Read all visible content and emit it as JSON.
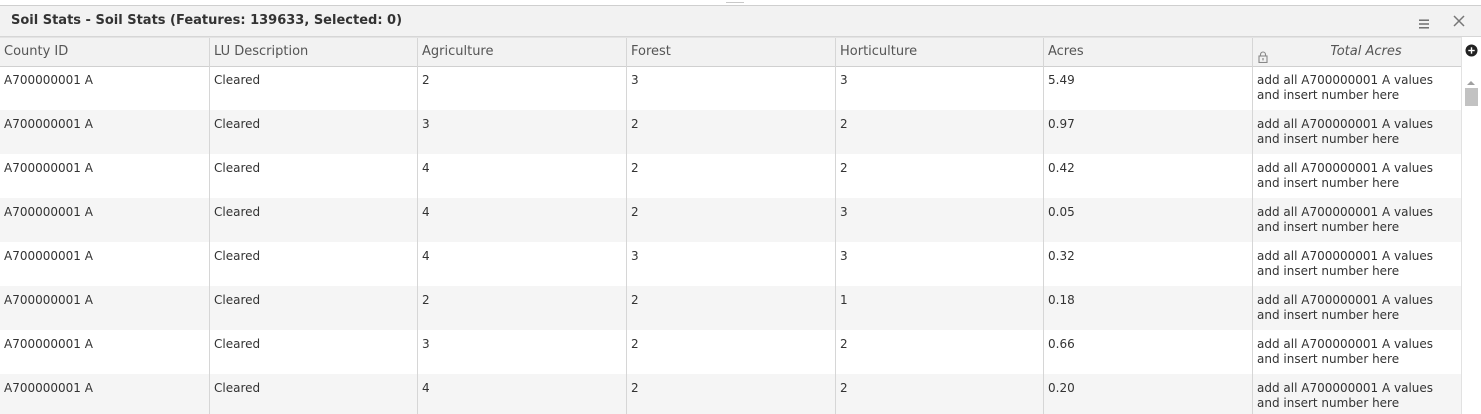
{
  "window": {
    "title": "Soil Stats - Soil Stats (Features: 139633, Selected: 0)",
    "menu_icon": "hamburger-menu-icon",
    "close_icon": "close-icon"
  },
  "table": {
    "columns": [
      "County ID",
      "LU Description",
      "Agriculture",
      "Forest",
      "Horticulture",
      "Acres",
      "Total Acres"
    ],
    "locked_column_icon": "lock-icon",
    "rows": [
      {
        "county_id": "A700000001 A",
        "lu_description": "Cleared",
        "agriculture": "2",
        "forest": "3",
        "horticulture": "3",
        "acres": "5.49",
        "total_acres": "add all A700000001 A values and insert number here"
      },
      {
        "county_id": "A700000001 A",
        "lu_description": "Cleared",
        "agriculture": "3",
        "forest": "2",
        "horticulture": "2",
        "acres": "0.97",
        "total_acres": "add all A700000001 A values and insert number here"
      },
      {
        "county_id": "A700000001 A",
        "lu_description": "Cleared",
        "agriculture": "4",
        "forest": "2",
        "horticulture": "2",
        "acres": "0.42",
        "total_acres": "add all A700000001 A values and insert number here"
      },
      {
        "county_id": "A700000001 A",
        "lu_description": "Cleared",
        "agriculture": "4",
        "forest": "2",
        "horticulture": "3",
        "acres": "0.05",
        "total_acres": "add all A700000001 A values and insert number here"
      },
      {
        "county_id": "A700000001 A",
        "lu_description": "Cleared",
        "agriculture": "4",
        "forest": "3",
        "horticulture": "3",
        "acres": "0.32",
        "total_acres": "add all A700000001 A values and insert number here"
      },
      {
        "county_id": "A700000001 A",
        "lu_description": "Cleared",
        "agriculture": "2",
        "forest": "2",
        "horticulture": "1",
        "acres": "0.18",
        "total_acres": "add all A700000001 A values and insert number here"
      },
      {
        "county_id": "A700000001 A",
        "lu_description": "Cleared",
        "agriculture": "3",
        "forest": "2",
        "horticulture": "2",
        "acres": "0.66",
        "total_acres": "add all A700000001 A values and insert number here"
      },
      {
        "county_id": "A700000001 A",
        "lu_description": "Cleared",
        "agriculture": "4",
        "forest": "2",
        "horticulture": "2",
        "acres": "0.20",
        "total_acres": "add all A700000001 A values and insert number here"
      }
    ]
  },
  "scrollbar": {
    "add_column_icon": "plus-circle-icon",
    "up_arrow_icon": "scroll-up-arrow-icon"
  }
}
